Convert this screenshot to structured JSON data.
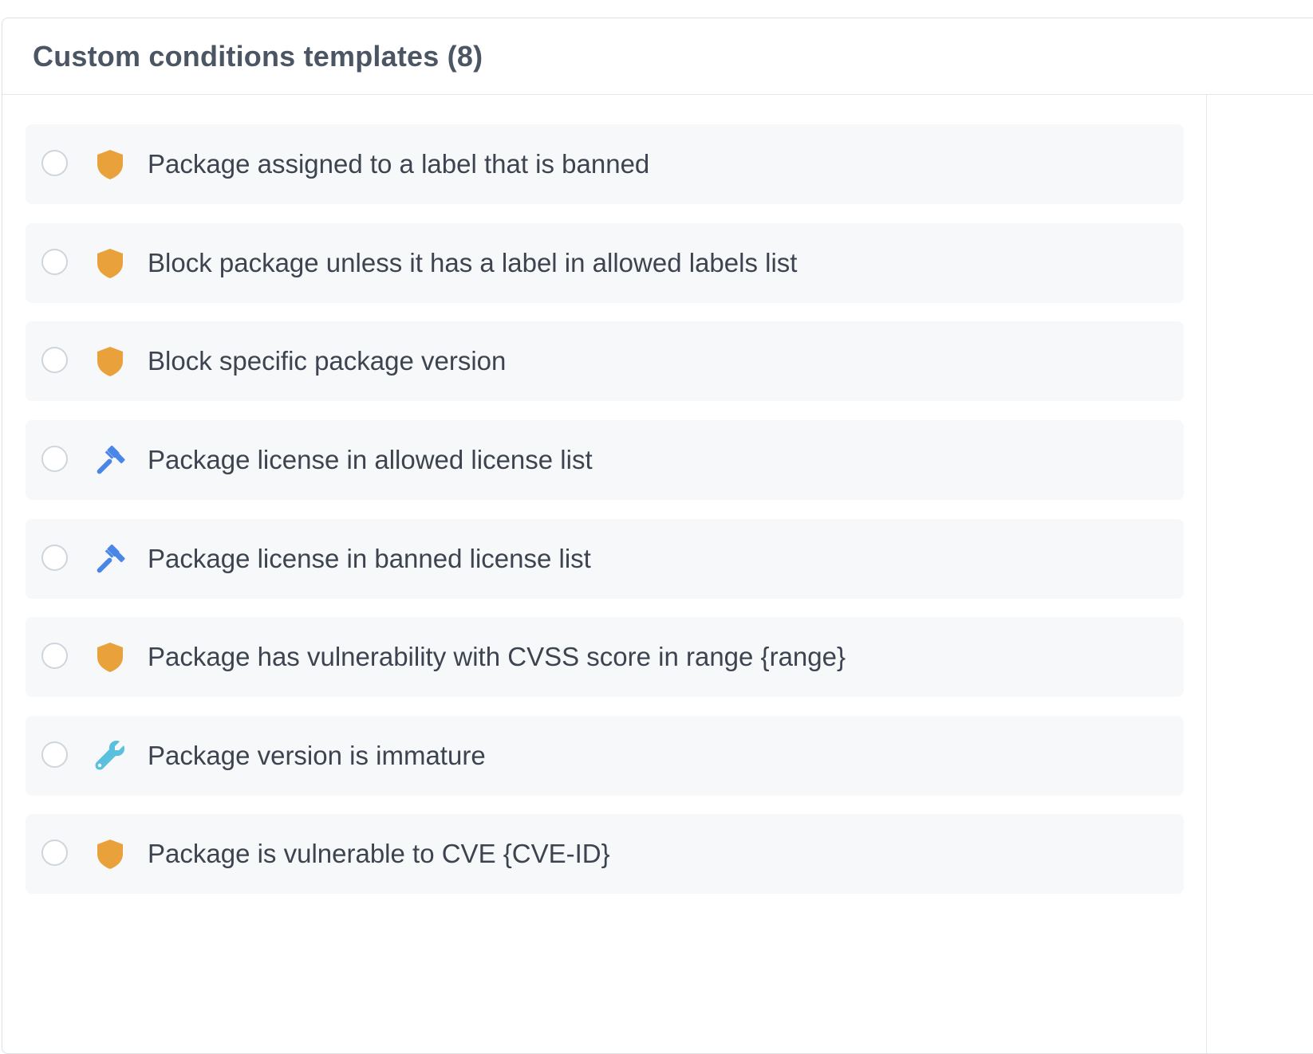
{
  "header": {
    "title": "Custom conditions templates (8)"
  },
  "items": [
    {
      "label": "Package assigned to a label that is banned",
      "icon": "shield-icon"
    },
    {
      "label": "Block package unless it has a label in allowed labels list",
      "icon": "shield-icon"
    },
    {
      "label": "Block specific package version",
      "icon": "shield-icon"
    },
    {
      "label": "Package license in allowed license list",
      "icon": "gavel-icon"
    },
    {
      "label": "Package license in banned license list",
      "icon": "gavel-icon"
    },
    {
      "label": "Package has vulnerability with CVSS score in range {range}",
      "icon": "shield-icon"
    },
    {
      "label": "Package version is immature",
      "icon": "wrench-icon"
    },
    {
      "label": "Package is vulnerable to CVE {CVE-ID}",
      "icon": "shield-icon"
    }
  ],
  "colors": {
    "shield": "#e9a23b",
    "gavel": "#4a86e8",
    "wrench": "#5bc0de"
  }
}
